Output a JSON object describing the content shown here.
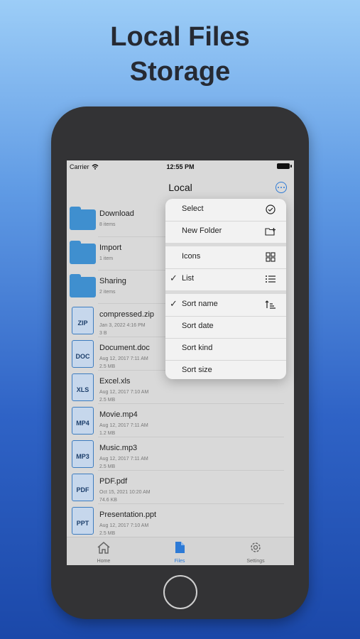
{
  "headline": {
    "line1": "Local Files",
    "line2": "Storage"
  },
  "status_bar": {
    "carrier": "Carrier",
    "time": "12:55 PM"
  },
  "nav": {
    "title": "Local"
  },
  "folders": [
    {
      "name": "Download",
      "sub": "8 items"
    },
    {
      "name": "Import",
      "sub": "1 item"
    },
    {
      "name": "Sharing",
      "sub": "2 items"
    }
  ],
  "files": [
    {
      "name": "compressed.zip",
      "ext": "ZIP",
      "date": "Jan 3, 2022 4:16 PM",
      "size": "3 B"
    },
    {
      "name": "Document.doc",
      "ext": "DOC",
      "date": "Aug 12, 2017 7:11 AM",
      "size": "2.5 MB"
    },
    {
      "name": "Excel.xls",
      "ext": "XLS",
      "date": "Aug 12, 2017 7:10 AM",
      "size": "2.5 MB"
    },
    {
      "name": "Movie.mp4",
      "ext": "MP4",
      "date": "Aug 12, 2017 7:11 AM",
      "size": "1.2 MB"
    },
    {
      "name": "Music.mp3",
      "ext": "MP3",
      "date": "Aug 12, 2017 7:11 AM",
      "size": "2.5 MB"
    },
    {
      "name": "PDF.pdf",
      "ext": "PDF",
      "date": "Oct 15, 2021 10:20 AM",
      "size": "74.6 KB"
    },
    {
      "name": "Presentation.ppt",
      "ext": "PPT",
      "date": "Aug 12, 2017 7:10 AM",
      "size": "2.5 MB"
    }
  ],
  "menu": {
    "select": "Select",
    "new_folder": "New Folder",
    "icons": "Icons",
    "list": "List",
    "sort_name": "Sort name",
    "sort_date": "Sort date",
    "sort_kind": "Sort kind",
    "sort_size": "Sort size",
    "checked_view": "list",
    "checked_sort": "sort_name"
  },
  "tabs": [
    {
      "label": "Home",
      "icon": "house-icon",
      "active": false
    },
    {
      "label": "Files",
      "icon": "file-icon",
      "active": true
    },
    {
      "label": "Settings",
      "icon": "gear-icon",
      "active": false
    }
  ],
  "colors": {
    "accent": "#2d7ad6",
    "folder": "#3f8fcf",
    "screen_bg": "#d9d9d9"
  }
}
